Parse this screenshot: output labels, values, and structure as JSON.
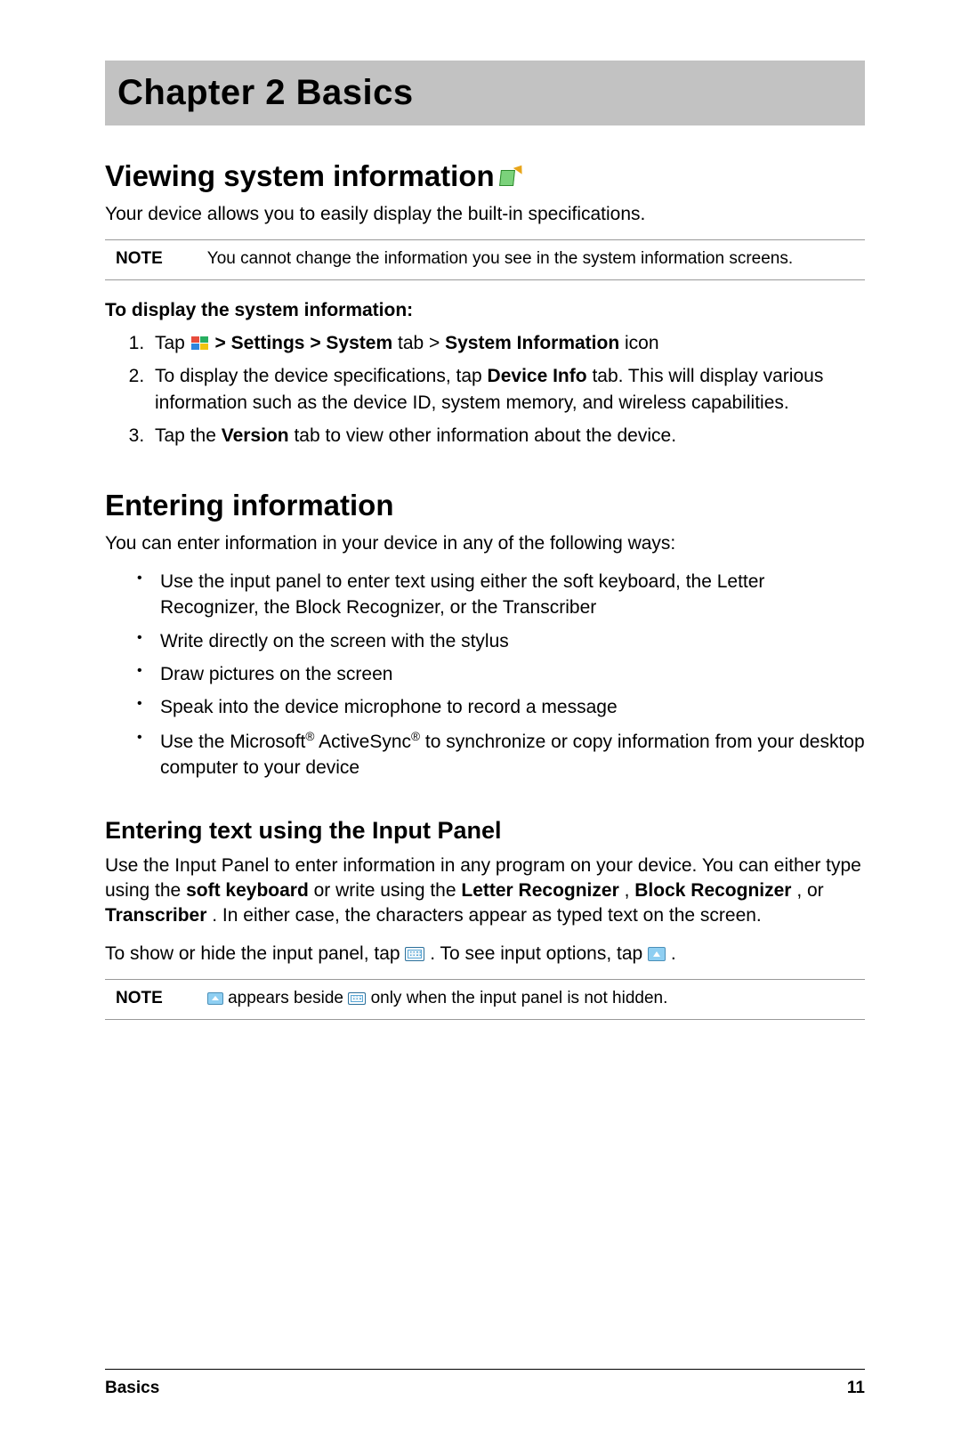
{
  "chapter": {
    "title": "Chapter 2  Basics"
  },
  "section_view": {
    "heading": "Viewing system information",
    "intro": "Your device allows you to easily display the built-in specifications.",
    "note_label": "NOTE",
    "note_body": "You cannot change the information you see in the system information screens.",
    "subheading": "To display the system information:",
    "step1_a": "Tap ",
    "step1_b_strong": " > Settings > System",
    "step1_c": " tab > ",
    "step1_d_strong": "System Information",
    "step1_e": " icon",
    "step2_a": "To display the device specifications, tap ",
    "step2_b_strong": "Device Info",
    "step2_c": " tab. This will display various information such as the device ID, system memory, and wireless capabilities.",
    "step3_a": "Tap the ",
    "step3_b_strong": "Version",
    "step3_c": " tab to view other information about the device."
  },
  "section_enter": {
    "heading": "Entering information",
    "intro": "You can enter information in your device in any of the following ways:",
    "bullets": [
      "Use the input panel to enter text using either the soft keyboard, the Letter Recognizer, the Block Recognizer, or the Transcriber",
      "Write directly on the screen with the stylus",
      "Draw pictures on the screen",
      "Speak into the device microphone to record a message"
    ],
    "bullet5_a": "Use the Microsoft",
    "bullet5_b": " ActiveSync",
    "bullet5_c": " to synchronize or copy information from your desktop computer to your device"
  },
  "section_input_panel": {
    "heading": "Entering text using the Input Panel",
    "para_a": "Use the Input Panel to enter information in any program on your device. You can either type using the ",
    "para_b_strong": "soft keyboard",
    "para_c": " or write using the ",
    "para_d_strong": "Letter Recognizer",
    "para_e": ", ",
    "para_f_strong": "Block Recognizer",
    "para_g": ", or ",
    "para_h_strong": "Transcriber",
    "para_i": ". In either case, the characters appear as typed text on the screen.",
    "show_a": "To show or hide the input panel, tap ",
    "show_b": ".  To see input options, tap ",
    "show_c": ".",
    "note_label": "NOTE",
    "note_body_a": " appears beside ",
    "note_body_b": " only when the input panel is not hidden."
  },
  "footer": {
    "section": "Basics",
    "page": "11"
  }
}
